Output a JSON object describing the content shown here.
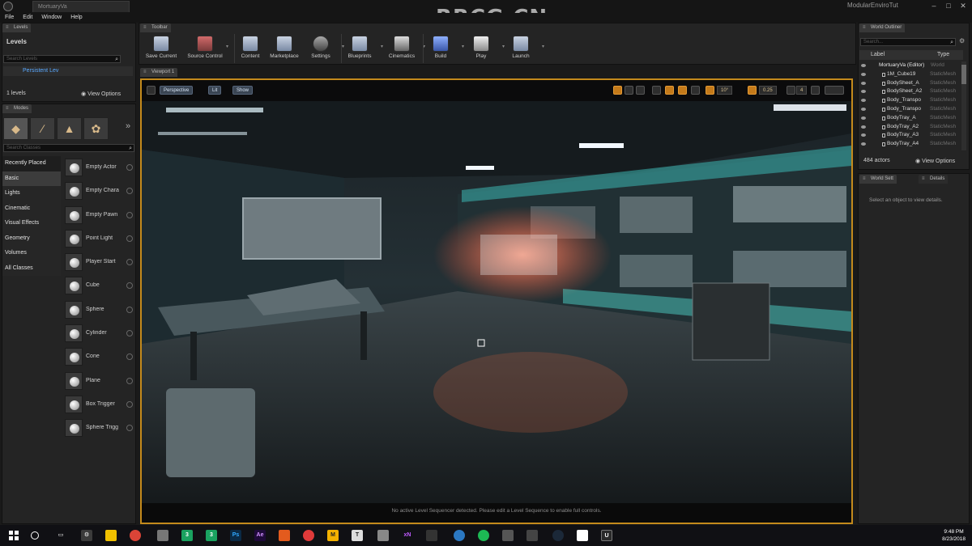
{
  "window": {
    "doc_tab": "MortuaryVa",
    "project_name": "ModularEnviroTut",
    "watermark": "RRCG.CN"
  },
  "menu": [
    "File",
    "Edit",
    "Window",
    "Help"
  ],
  "levels_panel": {
    "tab": "Levels",
    "title": "Levels",
    "search_placeholder": "Search Levels",
    "persistent_level": "Persistent Lev",
    "count": "1 levels",
    "view_options": "View Options"
  },
  "modes_panel": {
    "tab": "Modes",
    "search_placeholder": "Search Classes",
    "categories": [
      "Recently Placed",
      "Basic",
      "Lights",
      "Cinematic",
      "Visual Effects",
      "Geometry",
      "Volumes",
      "All Classes"
    ],
    "items": [
      "Empty Actor",
      "Empty Chara",
      "Empty Pawn",
      "Point Light",
      "Player Start",
      "Cube",
      "Sphere",
      "Cylinder",
      "Cone",
      "Plane",
      "Box Trigger",
      "Sphere Trigg"
    ]
  },
  "toolbar": {
    "tab": "Toolbar",
    "buttons": [
      "Save Current",
      "Source Control",
      "Content",
      "Marketplace",
      "Settings",
      "Blueprints",
      "Cinematics",
      "Build",
      "Play",
      "Launch"
    ]
  },
  "viewport": {
    "tab": "Viewport 1",
    "perspective": "Perspective",
    "lit": "Lit",
    "show": "Show",
    "snap_angle": "10°",
    "snap_scale": "0.25",
    "camera_speed": "4",
    "status": "No active Level Sequencer detected. Please edit a Level Sequence to enable full controls."
  },
  "world_outliner": {
    "tab": "World Outliner",
    "search_placeholder": "Search...",
    "col_label": "Label",
    "col_type": "Type",
    "rows": [
      {
        "name": "MortuaryVa (Editor)",
        "type": "World"
      },
      {
        "name": "1M_Cube19",
        "type": "StaticMesh"
      },
      {
        "name": "BodySheet_A",
        "type": "StaticMesh"
      },
      {
        "name": "BodySheet_A2",
        "type": "StaticMesh"
      },
      {
        "name": "Body_Transpo",
        "type": "StaticMesh"
      },
      {
        "name": "Body_Transpo",
        "type": "StaticMesh"
      },
      {
        "name": "BodyTray_A",
        "type": "StaticMesh"
      },
      {
        "name": "BodyTray_A2",
        "type": "StaticMesh"
      },
      {
        "name": "BodyTray_A3",
        "type": "StaticMesh"
      },
      {
        "name": "BodyTray_A4",
        "type": "StaticMesh"
      }
    ],
    "actors": "484 actors",
    "view_options": "View Options"
  },
  "details_panel": {
    "tab_world_settings": "World Sett",
    "tab_details": "Details",
    "message": "Select an object to view details."
  },
  "taskbar": {
    "time": "9:48 PM",
    "date": "8/23/2018"
  }
}
